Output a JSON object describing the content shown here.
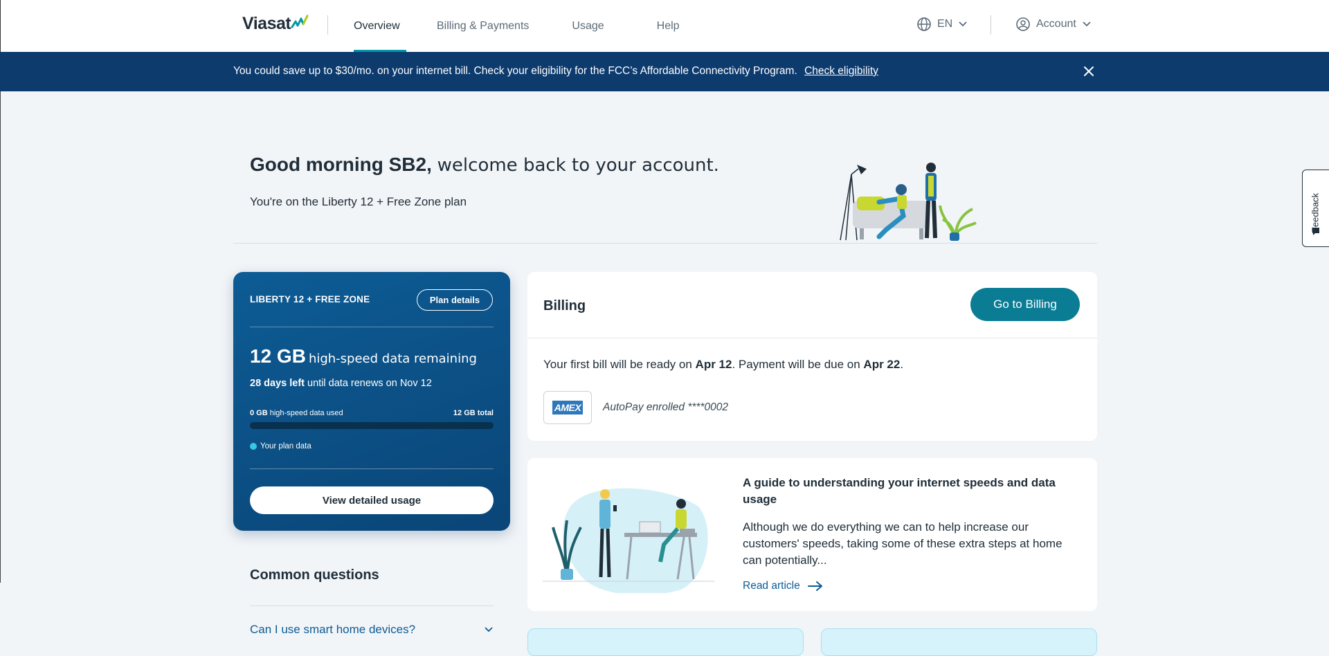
{
  "header": {
    "logo_text": "Viasat",
    "nav": [
      {
        "label": "Overview",
        "active": true
      },
      {
        "label": "Billing & Payments",
        "active": false
      },
      {
        "label": "Usage",
        "active": false
      },
      {
        "label": "Help",
        "active": false
      }
    ],
    "language": "EN",
    "account_label": "Account"
  },
  "banner": {
    "text": "You could save up to $30/mo. on your internet bill. Check your eligibility for the FCC’s Affordable Connectivity Program.",
    "link": "Check eligibility"
  },
  "welcome": {
    "greeting": "Good morning SB2,",
    "message": "welcome back to your account.",
    "plan_line": "You're on the Liberty 12 + Free Zone plan"
  },
  "plan_card": {
    "plan_name": "LIBERTY 12 + FREE ZONE",
    "plan_details_label": "Plan details",
    "data_amount": "12 GB",
    "data_text": "high-speed data remaining",
    "days_left": "28 days left",
    "renew_text": "until data renews on Nov 12",
    "used_amount": "0 GB",
    "used_text": "high-speed data used",
    "total_text": "12 GB total",
    "used_fraction": 0,
    "legend_label": "Your plan data",
    "view_usage_label": "View detailed usage"
  },
  "billing": {
    "title": "Billing",
    "button_label": "Go to Billing",
    "text_1": "Your first bill will be ready on",
    "date_ready": "Apr 12",
    "text_2": ". Payment will be due on",
    "date_due": "Apr 22",
    "text_3": ".",
    "card_brand": "AMEX",
    "autopay_text": "AutoPay enrolled ****0002"
  },
  "guide": {
    "title": "A guide to understanding your internet speeds and data usage",
    "body": "Although we do everything we can to help increase our customers' speeds, taking some of these extra steps at home can potentially...",
    "link": "Read article"
  },
  "common_questions": {
    "title": "Common questions",
    "items": [
      {
        "question": "Can I use smart home devices?"
      }
    ]
  },
  "feedback_label": "Feedback",
  "colors": {
    "brand_navy": "#0d3b6e",
    "accent_teal": "#0097a9",
    "billing_button": "#0a7d95",
    "usage_fill": "#35c6e8"
  }
}
